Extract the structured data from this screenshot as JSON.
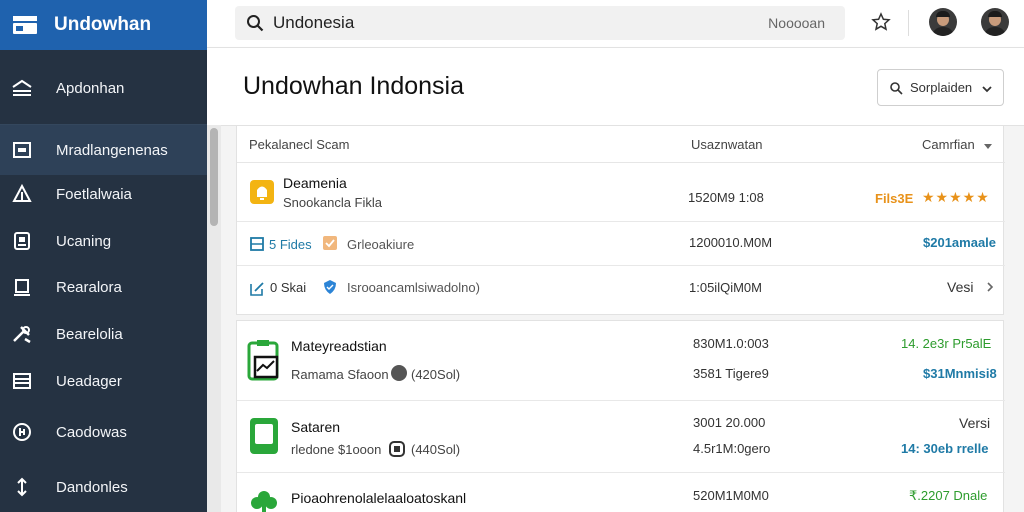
{
  "brand": {
    "title": "Undowhan"
  },
  "sidebar": {
    "items": [
      {
        "label": "Apdonhan",
        "icon": "home-icon"
      },
      {
        "label": "Mradlangenenas",
        "icon": "square-icon"
      },
      {
        "label": "Foetlalwaia",
        "icon": "triangle-icon"
      },
      {
        "label": "Ucaning",
        "icon": "document-icon"
      },
      {
        "label": "Rearalora",
        "icon": "screen-icon"
      },
      {
        "label": "Bearelolia",
        "icon": "tools-icon"
      },
      {
        "label": "Ueadager",
        "icon": "list-icon"
      },
      {
        "label": "Caodowas",
        "icon": "coin-icon"
      },
      {
        "label": "Dandonles",
        "icon": "transfer-icon"
      }
    ]
  },
  "search": {
    "value": "Undonesia",
    "hint": "Nooooan"
  },
  "header": {
    "title": "Undowhan Indonsia",
    "dropdown_label": "Sorplaiden"
  },
  "table": {
    "columns": [
      "Pekalanecl Scam",
      "Usaznwatan",
      "Camrfian"
    ]
  },
  "rows": [
    {
      "title": "Deamenia",
      "subtitle": "Snookancla Fikla",
      "amount": "1520M9 1:08",
      "tag": "Fils3E",
      "stars": "★★★★★"
    },
    {
      "count": "5 Fides",
      "label": "Grleoakiure",
      "amount": "1200010.M0M",
      "value": "$201amaale"
    },
    {
      "count": "0 Skai",
      "label": "Isrooancamlsiwadolno)",
      "amount": "1:05ilQiM0M",
      "action": "Vesi"
    }
  ],
  "rows2": [
    {
      "title": "Mateyreadstian",
      "sub": "Ramama Sfaoon",
      "sub_tag": "(420Sol)",
      "amount1": "830M1.0:003",
      "amount2": "3581 Tigere9",
      "value1": "14. 2e3r Pr5alE",
      "value2": "$31Mnmisi8"
    },
    {
      "title": "Sataren",
      "sub": "rledone $1ooon",
      "sub_tag": "(440Sol)",
      "amount1": "3001 20.000",
      "amount2": "4.5r1M:0gero",
      "value1": "Versi",
      "value2": "14: 30eb rrelle"
    },
    {
      "title": "Pioaohrenolalelaaloatoskanl",
      "amount1": "520M1M0M0",
      "value1": "₹.2207 Dnale"
    }
  ],
  "colors": {
    "brand": "#1f62ae",
    "sidebar": "#253242",
    "accent_green": "#2d9c2d",
    "accent_teal": "#1f7aa6",
    "star": "#e8921a"
  }
}
